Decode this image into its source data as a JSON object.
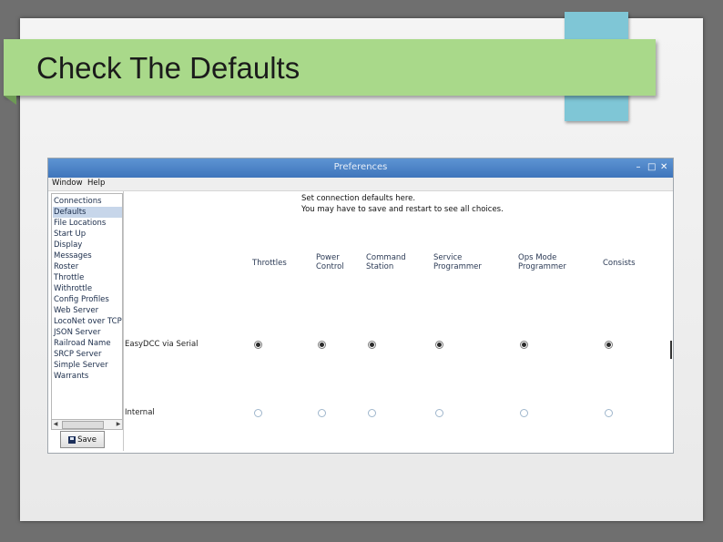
{
  "slide": {
    "title": "Check The Defaults",
    "banner_color": "#a9d98a",
    "accent_color": "#7fc6d6"
  },
  "window": {
    "title": "Preferences",
    "controls": [
      "minimize-icon",
      "maximize-icon",
      "close-icon"
    ],
    "menu": [
      "Window",
      "Help"
    ],
    "sidebar_items": [
      "Connections",
      "Defaults",
      "File Locations",
      "Start Up",
      "Display",
      "Messages",
      "Roster",
      "Throttle",
      "Withrottle",
      "Config Profiles",
      "Web Server",
      "LocoNet over TCP S",
      "JSON Server",
      "Railroad Name",
      "SRCP Server",
      "Simple Server",
      "Warrants"
    ],
    "selected_item": "Defaults",
    "save_label": "Save",
    "info_lines": [
      "Set connection defaults here.",
      "You may have to save and restart to see all choices."
    ],
    "columns": [
      "Throttles",
      "Power\nControl",
      "Command\nStation",
      "Service\nProgrammer",
      "Ops Mode\nProgrammer",
      "Consists"
    ],
    "rows": [
      {
        "label": "EasyDCC via Serial",
        "selected": [
          true,
          true,
          true,
          true,
          true,
          true
        ]
      },
      {
        "label": "Internal",
        "selected": [
          false,
          false,
          false,
          false,
          false,
          false
        ]
      }
    ]
  }
}
